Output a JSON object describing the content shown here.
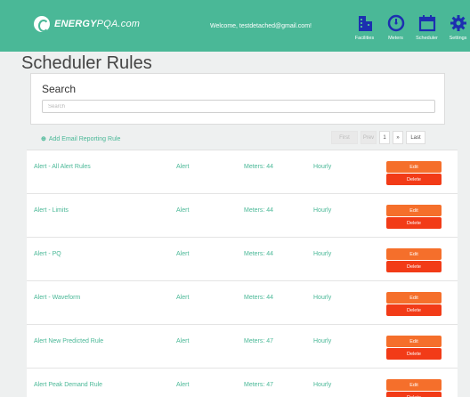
{
  "header": {
    "brand_bold": "ENERGY",
    "brand_light": "PQA.com",
    "welcome": "Welcome, testdetached@gmail.com!",
    "nav": [
      {
        "label": "Facilities",
        "icon": "building-icon"
      },
      {
        "label": "Meters",
        "icon": "gauge-icon"
      },
      {
        "label": "Scheduler",
        "icon": "calendar-icon"
      },
      {
        "label": "Settings",
        "icon": "gear-icon"
      }
    ]
  },
  "page": {
    "title": "Scheduler Rules"
  },
  "search": {
    "label": "Search",
    "placeholder": "Search"
  },
  "actions": {
    "add_rule": "Add Email Reporting Rule"
  },
  "pager": {
    "first": "First",
    "prev": "Prev",
    "page": "1",
    "next": "»",
    "last": "Last"
  },
  "buttons": {
    "edit": "Edit",
    "delete": "Delete"
  },
  "rules": [
    {
      "name": "Alert - All Alert Rules",
      "type": "Alert",
      "meter": "Meters: 44",
      "frequency": "Hourly"
    },
    {
      "name": "Alert - Limits",
      "type": "Alert",
      "meter": "Meters: 44",
      "frequency": "Hourly"
    },
    {
      "name": "Alert - PQ",
      "type": "Alert",
      "meter": "Meters: 44",
      "frequency": "Hourly"
    },
    {
      "name": "Alert - Waveform",
      "type": "Alert",
      "meter": "Meters: 44",
      "frequency": "Hourly"
    },
    {
      "name": "Alert New Predicted Rule",
      "type": "Alert",
      "meter": "Meters: 47",
      "frequency": "Hourly"
    },
    {
      "name": "Alert Peak Demand Rule",
      "type": "Alert",
      "meter": "Meters: 47",
      "frequency": "Hourly"
    }
  ],
  "colors": {
    "brand": "#4ab897",
    "edit": "#f56f2b",
    "delete": "#f23b17",
    "nav_icon": "#1c2fb0"
  }
}
